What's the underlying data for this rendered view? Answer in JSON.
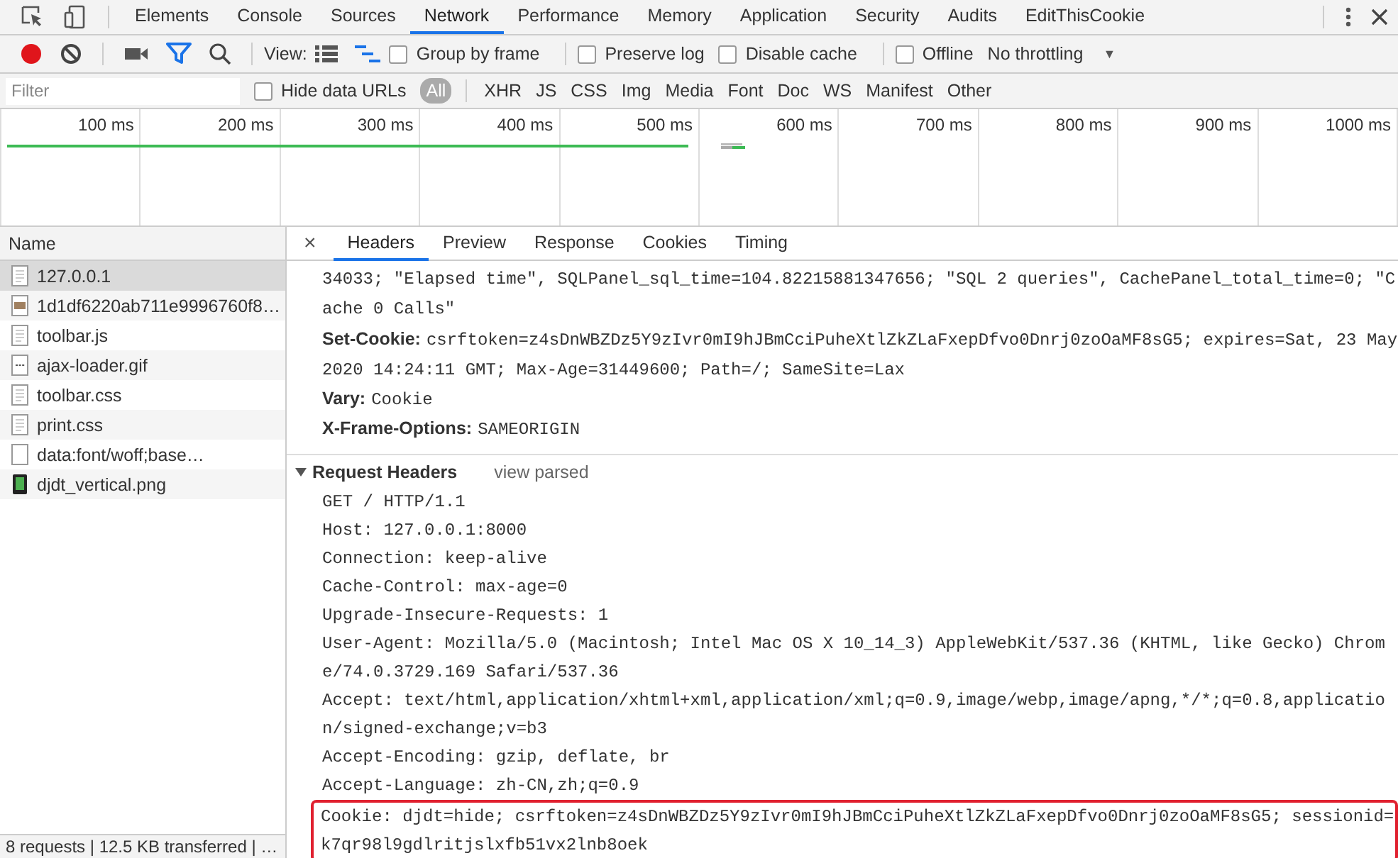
{
  "panel_tabs": [
    {
      "label": "Elements",
      "selected": false
    },
    {
      "label": "Console",
      "selected": false
    },
    {
      "label": "Sources",
      "selected": false
    },
    {
      "label": "Network",
      "selected": true
    },
    {
      "label": "Performance",
      "selected": false
    },
    {
      "label": "Memory",
      "selected": false
    },
    {
      "label": "Application",
      "selected": false
    },
    {
      "label": "Security",
      "selected": false
    },
    {
      "label": "Audits",
      "selected": false
    },
    {
      "label": "EditThisCookie",
      "selected": false
    }
  ],
  "toolbar": {
    "recording": true,
    "filter_active": true,
    "view_label": "View:",
    "large_rows": false,
    "waterfall_view": true,
    "checkboxes": [
      {
        "label": "Group by frame",
        "checked": false
      },
      {
        "label": "Preserve log",
        "checked": false
      },
      {
        "label": "Disable cache",
        "checked": false
      },
      {
        "label": "Offline",
        "checked": false
      }
    ],
    "throttling": "No throttling",
    "dropdown_arrow": "▼"
  },
  "filter_bar": {
    "placeholder": "Filter",
    "hide_data_urls": {
      "label": "Hide data URLs",
      "checked": false
    },
    "types": [
      {
        "label": "All",
        "selected": true
      },
      {
        "label": "XHR",
        "selected": false
      },
      {
        "label": "JS",
        "selected": false
      },
      {
        "label": "CSS",
        "selected": false
      },
      {
        "label": "Img",
        "selected": false
      },
      {
        "label": "Media",
        "selected": false
      },
      {
        "label": "Font",
        "selected": false
      },
      {
        "label": "Doc",
        "selected": false
      },
      {
        "label": "WS",
        "selected": false
      },
      {
        "label": "Manifest",
        "selected": false
      },
      {
        "label": "Other",
        "selected": false
      }
    ]
  },
  "overview": {
    "ticks": [
      "100 ms",
      "200 ms",
      "300 ms",
      "400 ms",
      "500 ms",
      "600 ms",
      "700 ms",
      "800 ms",
      "900 ms",
      "1000 ms"
    ]
  },
  "requests": {
    "column": "Name",
    "rows": [
      {
        "name": "127.0.0.1",
        "kind": "document",
        "selected": true
      },
      {
        "name": "1d1df6220ab711e9996760f8…",
        "kind": "image",
        "selected": false
      },
      {
        "name": "toolbar.js",
        "kind": "document",
        "selected": false
      },
      {
        "name": "ajax-loader.gif",
        "kind": "gif",
        "selected": false
      },
      {
        "name": "toolbar.css",
        "kind": "document",
        "selected": false
      },
      {
        "name": "print.css",
        "kind": "document",
        "selected": false
      },
      {
        "name": "data:font/woff;base…",
        "kind": "blank",
        "selected": false
      },
      {
        "name": "djdt_vertical.png",
        "kind": "phone",
        "selected": false
      }
    ],
    "status": "8 requests | 12.5 KB transferred | …"
  },
  "detail": {
    "close": "×",
    "tabs": [
      {
        "label": "Headers",
        "selected": true
      },
      {
        "label": "Preview",
        "selected": false
      },
      {
        "label": "Response",
        "selected": false
      },
      {
        "label": "Cookies",
        "selected": false
      },
      {
        "label": "Timing",
        "selected": false
      }
    ],
    "response_headers": [
      {
        "value": "34033; \"Elapsed time\", SQLPanel_sql_time=104.82215881347656; \"SQL 2 queries\", CachePanel_total_time=0; \"Cache 0 Calls\""
      },
      {
        "name": "Set-Cookie:",
        "value": "csrftoken=z4sDnWBZDz5Y9zIvr0mI9hJBmCciPuheXtlZkZLaFxepDfvo0Dnrj0zoOaMF8sG5; expires=Sat, 23 May 2020 14:24:11 GMT; Max-Age=31449600; Path=/; SameSite=Lax"
      },
      {
        "name": "Vary:",
        "value": "Cookie"
      },
      {
        "name": "X-Frame-Options:",
        "value": "SAMEORIGIN"
      }
    ],
    "request_section": {
      "title": "Request Headers",
      "expanded": true,
      "link": "view parsed"
    },
    "request_headers": [
      {
        "text": "GET / HTTP/1.1",
        "highlighted": false
      },
      {
        "text": "Host: 127.0.0.1:8000",
        "highlighted": false
      },
      {
        "text": "Connection: keep-alive",
        "highlighted": false
      },
      {
        "text": "Cache-Control: max-age=0",
        "highlighted": false
      },
      {
        "text": "Upgrade-Insecure-Requests: 1",
        "highlighted": false
      },
      {
        "text": "User-Agent: Mozilla/5.0 (Macintosh; Intel Mac OS X 10_14_3) AppleWebKit/537.36 (KHTML, like Gecko) Chrome/74.0.3729.169 Safari/537.36",
        "highlighted": false
      },
      {
        "text": "Accept: text/html,application/xhtml+xml,application/xml;q=0.9,image/webp,image/apng,*/*;q=0.8,application/signed-exchange;v=b3",
        "highlighted": false
      },
      {
        "text": "Accept-Encoding: gzip, deflate, br",
        "highlighted": false
      },
      {
        "text": "Accept-Language: zh-CN,zh;q=0.9",
        "highlighted": false
      },
      {
        "text": "Cookie: djdt=hide; csrftoken=z4sDnWBZDz5Y9zIvr0mI9hJBmCciPuheXtlZkZLaFxepDfvo0Dnrj0zoOaMF8sG5; sessionid=k7qr98l9gdlritjslxfb51vx2lnb8oek",
        "highlighted": true
      }
    ]
  }
}
